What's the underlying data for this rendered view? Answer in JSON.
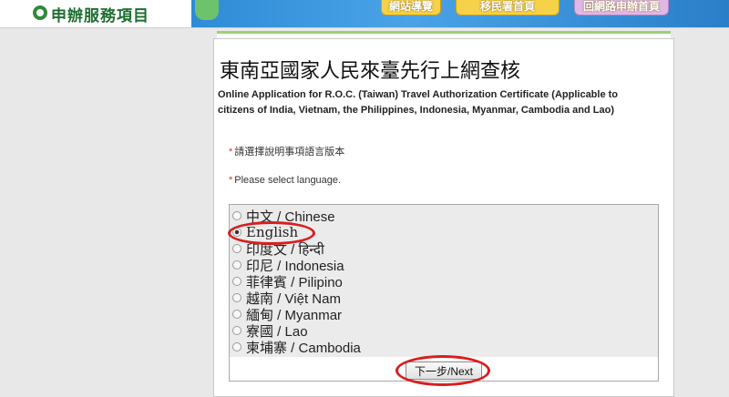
{
  "header": {
    "brand_label": "申辦服務項目",
    "nav": [
      "網站導覽",
      "移民署首頁",
      "回網路申辦首頁"
    ]
  },
  "page": {
    "title": "東南亞國家人民來臺先行上網查核",
    "subtitle": "Online Application for R.O.C. (Taiwan) Travel Authorization Certificate (Applicable to citizens of India, Vietnam, the Philippines, Indonesia, Myanmar, Cambodia and Lao)",
    "required_mark": "*",
    "prompt_zh": "請選擇說明事項語言版本",
    "prompt_en": "Please select language."
  },
  "languages": [
    {
      "native": "中文",
      "name": "Chinese",
      "selected": false
    },
    {
      "native": "",
      "name": "English",
      "selected": true
    },
    {
      "native": "印度文",
      "name": "हिन्दी",
      "selected": false
    },
    {
      "native": "印尼",
      "name": "Indonesia",
      "selected": false
    },
    {
      "native": "菲律賓",
      "name": "Pilipino",
      "selected": false
    },
    {
      "native": "越南",
      "name": "Việt Nam",
      "selected": false
    },
    {
      "native": "緬甸",
      "name": "Myanmar",
      "selected": false
    },
    {
      "native": "寮國",
      "name": "Lao",
      "selected": false
    },
    {
      "native": "柬埔寨",
      "name": "Cambodia",
      "selected": false
    }
  ],
  "next_button_label": "下一步/Next",
  "annotation_color": "#d81e1e"
}
